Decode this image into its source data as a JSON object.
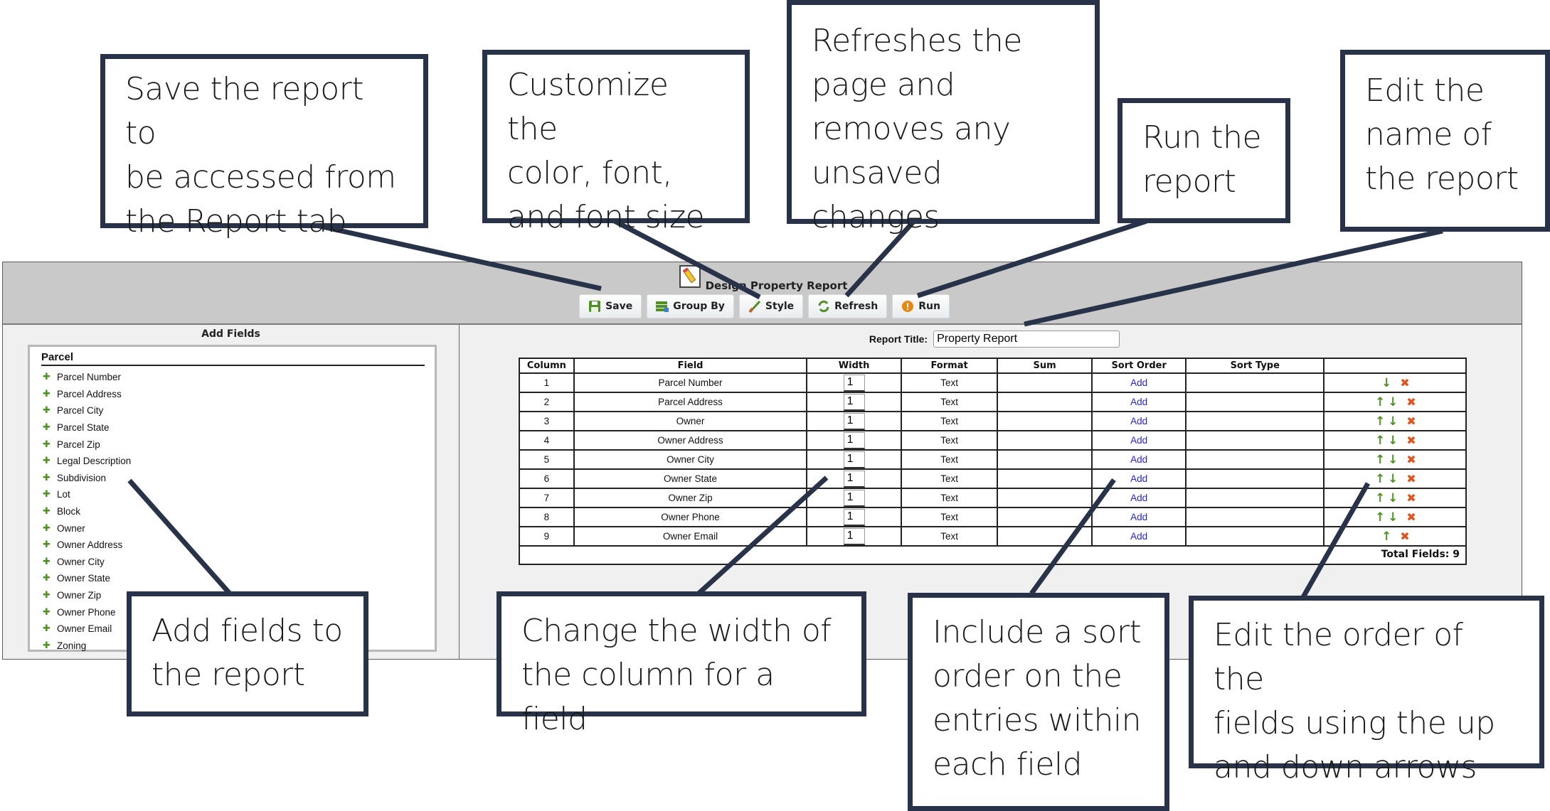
{
  "app": {
    "header_title": "Design Property Report",
    "toolbar": [
      {
        "id": "save",
        "label": "Save",
        "icon": "save-icon"
      },
      {
        "id": "group-by",
        "label": "Group By",
        "icon": "group-by-icon"
      },
      {
        "id": "style",
        "label": "Style",
        "icon": "paintbrush-icon"
      },
      {
        "id": "refresh",
        "label": "Refresh",
        "icon": "refresh-icon"
      },
      {
        "id": "run",
        "label": "Run",
        "icon": "run-icon"
      }
    ],
    "add_fields": {
      "title": "Add Fields",
      "group": "Parcel",
      "items": [
        "Parcel Number",
        "Parcel Address",
        "Parcel City",
        "Parcel State",
        "Parcel Zip",
        "Legal Description",
        "Subdivision",
        "Lot",
        "Block",
        "Owner",
        "Owner Address",
        "Owner City",
        "Owner State",
        "Owner Zip",
        "Owner Phone",
        "Owner Email",
        "Zoning"
      ]
    },
    "report_title_label": "Report Title:",
    "report_title_value": "Property Report",
    "table": {
      "headers": [
        "Column",
        "Field",
        "Width",
        "Format",
        "Sum",
        "Sort Order",
        "Sort Type",
        ""
      ],
      "rows": [
        {
          "column": "1",
          "field": "Parcel Number",
          "width": "1",
          "format": "Text",
          "sum": "",
          "sort_order": "Add",
          "sort_type": "",
          "up": false,
          "down": true
        },
        {
          "column": "2",
          "field": "Parcel Address",
          "width": "1",
          "format": "Text",
          "sum": "",
          "sort_order": "Add",
          "sort_type": "",
          "up": true,
          "down": true
        },
        {
          "column": "3",
          "field": "Owner",
          "width": "1",
          "format": "Text",
          "sum": "",
          "sort_order": "Add",
          "sort_type": "",
          "up": true,
          "down": true
        },
        {
          "column": "4",
          "field": "Owner Address",
          "width": "1",
          "format": "Text",
          "sum": "",
          "sort_order": "Add",
          "sort_type": "",
          "up": true,
          "down": true
        },
        {
          "column": "5",
          "field": "Owner City",
          "width": "1",
          "format": "Text",
          "sum": "",
          "sort_order": "Add",
          "sort_type": "",
          "up": true,
          "down": true
        },
        {
          "column": "6",
          "field": "Owner State",
          "width": "1",
          "format": "Text",
          "sum": "",
          "sort_order": "Add",
          "sort_type": "",
          "up": true,
          "down": true
        },
        {
          "column": "7",
          "field": "Owner Zip",
          "width": "1",
          "format": "Text",
          "sum": "",
          "sort_order": "Add",
          "sort_type": "",
          "up": true,
          "down": true
        },
        {
          "column": "8",
          "field": "Owner Phone",
          "width": "1",
          "format": "Text",
          "sum": "",
          "sort_order": "Add",
          "sort_type": "",
          "up": true,
          "down": true
        },
        {
          "column": "9",
          "field": "Owner Email",
          "width": "1",
          "format": "Text",
          "sum": "",
          "sort_order": "Add",
          "sort_type": "",
          "up": true,
          "down": false
        }
      ],
      "total_label": "Total Fields: 9"
    }
  },
  "callouts": {
    "save": [
      "Save the report to",
      "be accessed from",
      "the Report tab"
    ],
    "style": [
      "Customize the",
      "color, font,",
      "and font size"
    ],
    "refresh": [
      "Refreshes the",
      "page and",
      "removes any",
      "unsaved changes"
    ],
    "run": [
      "Run the",
      "report"
    ],
    "title": [
      "Edit the",
      "name of",
      "the report"
    ],
    "add_fields": [
      "Add fields to",
      "the report"
    ],
    "width": [
      "Change the width of",
      "the column for a field"
    ],
    "sort": [
      "Include a sort",
      "order on the",
      "entries within",
      "each field"
    ],
    "order": [
      "Edit the order of the",
      "fields using the up",
      "and down arrows"
    ]
  },
  "colors": {
    "callout_border": "#28334a",
    "header_bg": "#c9c9c9",
    "panel_bg": "#f0f0f0",
    "icon_green": "#4e8f26",
    "delete_orange": "#e0531a",
    "link_blue": "#2323e6"
  }
}
